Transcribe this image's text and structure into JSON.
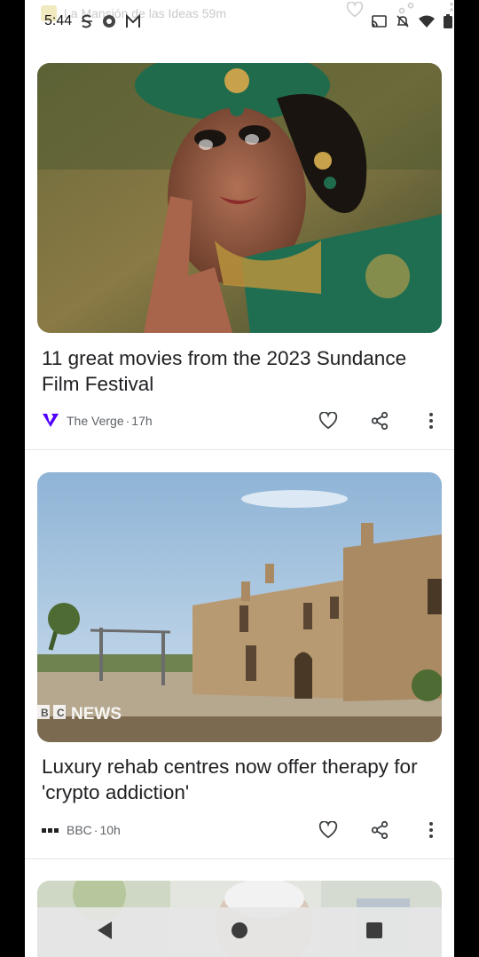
{
  "status_bar": {
    "time": "5:44",
    "ghost_source": "La Mansión de las Ideas",
    "ghost_age": "59m",
    "icons": [
      "s-icon",
      "chrome-icon",
      "gmail-icon",
      "cast-icon",
      "bell-off-icon",
      "wifi-icon",
      "battery-icon"
    ]
  },
  "articles": [
    {
      "headline": "11 great movies from the 2023 Sundance Film Festival",
      "source": "The Verge",
      "age": "17h",
      "source_icon": "verge-logo-icon",
      "image_desc_icon": "dancer-photo"
    },
    {
      "headline": "Luxury rehab centres now offer therapy for 'crypto addiction'",
      "source": "BBC",
      "age": "10h",
      "source_icon": "bbc-logo-icon",
      "watermark": "NEWS",
      "image_desc_icon": "villa-photo"
    }
  ],
  "separator": " · ",
  "colors": {
    "verge_purple": "#5200ff",
    "text": "#202124",
    "meta": "#5f6368"
  },
  "nav": {
    "back_icon": "back-icon",
    "home_icon": "home-icon",
    "recents_icon": "recents-icon"
  }
}
